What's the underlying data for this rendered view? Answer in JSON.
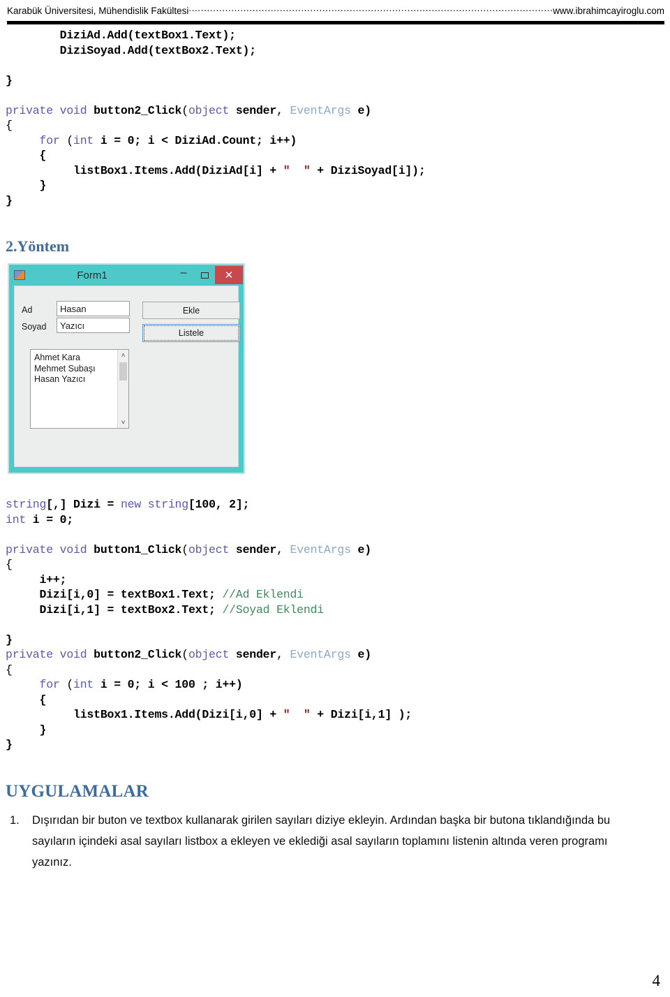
{
  "header": {
    "left": "Karabük Üniversitesi, Mühendislik Fakültesi",
    "right": "www.ibrahimcayiroglu.com"
  },
  "code_block_1": {
    "lines": [
      "        DiziAd.Add(textBox1.Text);",
      "        DiziSoyad.Add(textBox2.Text);",
      "",
      "}",
      "",
      "private void button2_Click(object sender, EventArgs e)",
      "{",
      "     for (int i = 0; i < DiziAd.Count; i++)",
      "     {",
      "          listBox1.Items.Add(DiziAd[i] + \"  \" + DiziSoyad[i]);",
      "     }",
      "}"
    ]
  },
  "headings": {
    "yontem": "2.Yöntem",
    "uygulamalar": "UYGULAMALAR"
  },
  "form": {
    "title": "Form1",
    "app_icon": "form-app-icon",
    "minimize_glyph": "–",
    "maximize_glyph": "▭",
    "close_glyph": "✕",
    "label_ad": "Ad",
    "label_soyad": "Soyad",
    "input_ad_value": "Hasan",
    "input_soyad_value": "Yazıcı",
    "button_ekle": "Ekle",
    "button_listele": "Listele",
    "listbox_items": "Ahmet  Kara\nMehmet  Subaşı\nHasan  Yazıcı",
    "scroll_up_glyph": "˄",
    "scroll_down_glyph": "˅",
    "titlebar_color": "#4ec9c9",
    "close_button_color": "#c8484c",
    "body_color": "#eceded"
  },
  "code_block_2": {
    "lines": [
      "string[,] Dizi = new string[100, 2];",
      "int i = 0;",
      "",
      "private void button1_Click(object sender, EventArgs e)",
      "{",
      "     i++;",
      "     Dizi[i,0] = textBox1.Text; //Ad Eklendi",
      "     Dizi[i,1] = textBox2.Text; //Soyad Eklendi",
      "",
      "}",
      "private void button2_Click(object sender, EventArgs e)",
      "{",
      "     for (int i = 0; i < 100 ; i++)",
      "     {",
      "          listBox1.Items.Add(Dizi[i,0] + \"  \" + Dizi[i,1] );",
      "     }",
      "}"
    ]
  },
  "applications": [
    {
      "number": "1.",
      "text": "Dışırıdan bir buton ve textbox kullanarak girilen sayıları diziye ekleyin. Ardından başka bir butona tıklandığında bu sayıların içindeki asal sayıları listbox a ekleyen ve eklediği asal sayıların toplamını listenin altında veren programı yazınız."
    }
  ],
  "footer": {
    "page_number": "4"
  },
  "colors": {
    "heading_blue": "#3e6b9e",
    "keyword": "#5a5ab0",
    "type": "#8fa8c8",
    "string": "#a31515",
    "comment": "#3e8b5c"
  }
}
